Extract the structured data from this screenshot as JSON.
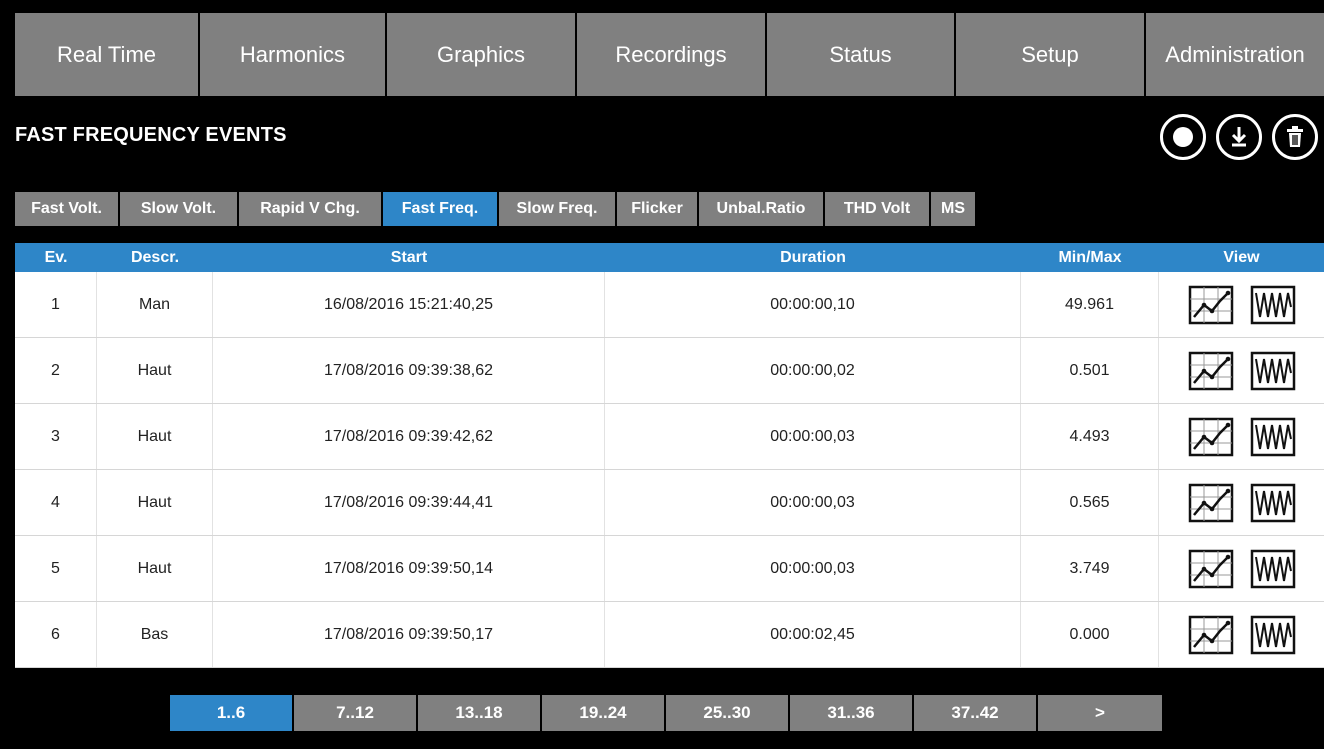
{
  "topnav": [
    "Real Time",
    "Harmonics",
    "Graphics",
    "Recordings",
    "Status",
    "Setup",
    "Administration"
  ],
  "page": {
    "title": "FAST FREQUENCY EVENTS"
  },
  "actions": [
    {
      "icon": "record-icon"
    },
    {
      "icon": "download-icon"
    },
    {
      "icon": "trash-icon"
    }
  ],
  "subtabs": [
    "Fast Volt.",
    "Slow Volt.",
    "Rapid V Chg.",
    "Fast Freq.",
    "Slow Freq.",
    "Flicker",
    "Unbal.Ratio",
    "THD Volt",
    "MS"
  ],
  "active_subtab": "Fast Freq.",
  "table": {
    "headers": {
      "ev": "Ev.",
      "desc": "Descr.",
      "start": "Start",
      "duration": "Duration",
      "minmax": "Min/Max",
      "view": "View"
    },
    "rows": [
      {
        "ev": "1",
        "desc": "Man",
        "start": "16/08/2016 15:21:40,25",
        "duration": "00:00:00,10",
        "minmax": "49.961"
      },
      {
        "ev": "2",
        "desc": "Haut",
        "start": "17/08/2016 09:39:38,62",
        "duration": "00:00:00,02",
        "minmax": "0.501"
      },
      {
        "ev": "3",
        "desc": "Haut",
        "start": "17/08/2016 09:39:42,62",
        "duration": "00:00:00,03",
        "minmax": "4.493"
      },
      {
        "ev": "4",
        "desc": "Haut",
        "start": "17/08/2016 09:39:44,41",
        "duration": "00:00:00,03",
        "minmax": "0.565"
      },
      {
        "ev": "5",
        "desc": "Haut",
        "start": "17/08/2016 09:39:50,14",
        "duration": "00:00:00,03",
        "minmax": "3.749"
      },
      {
        "ev": "6",
        "desc": "Bas",
        "start": "17/08/2016 09:39:50,17",
        "duration": "00:00:02,45",
        "minmax": "0.000"
      }
    ]
  },
  "pager": [
    "1..6",
    "7..12",
    "13..18",
    "19..24",
    "25..30",
    "31..36",
    "37..42",
    ">"
  ],
  "active_page": "1..6",
  "colors": {
    "accent": "#2e86c8",
    "tab_bg": "#808080",
    "background": "#000000"
  }
}
